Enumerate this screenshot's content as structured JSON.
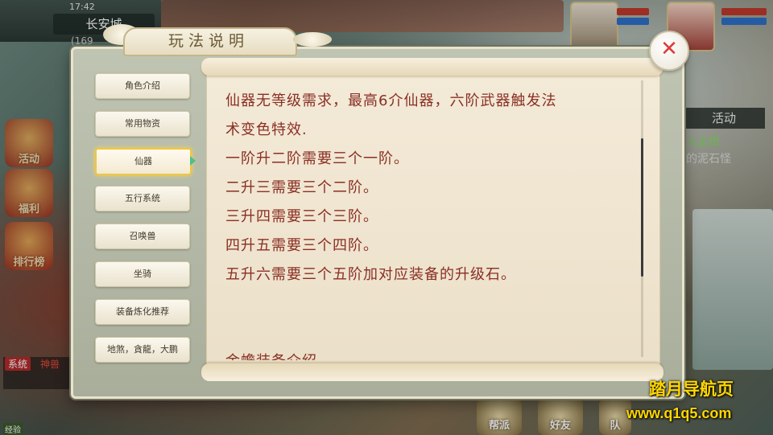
{
  "hud": {
    "time": "17:42",
    "city": "长安城",
    "coord": "(169",
    "left_icons": [
      "活动",
      "福利",
      "排行榜"
    ],
    "right_tab": "活动",
    "quest_line1": "入尘世",
    "quest_line2": "的泥石怪",
    "chat_tag": "系统",
    "chat_text": "神兽",
    "bottom_buttons": [
      "帮派",
      "好友",
      "队"
    ],
    "bottom_left_label": "经验"
  },
  "dialog": {
    "title": "玩法说明",
    "menu": [
      {
        "label": "角色介绍",
        "active": false
      },
      {
        "label": "常用物资",
        "active": false
      },
      {
        "label": "仙器",
        "active": true
      },
      {
        "label": "五行系统",
        "active": false
      },
      {
        "label": "召唤兽",
        "active": false
      },
      {
        "label": "坐骑",
        "active": false
      },
      {
        "label": "装备炼化推荐",
        "active": false
      },
      {
        "label": "地煞，貪龍，大鹏",
        "active": false
      }
    ],
    "content_lines": [
      "仙器无等级需求，最高6介仙器，六阶武器触发法",
      "术变色特效.",
      "一阶升二阶需要三个一阶。",
      "二升三需要三个二阶。",
      "三升四需要三个三阶。",
      "四升五需要三个四阶。",
      "五升六需要三个五阶加对应装备的升级石。",
      "",
      "",
      "金蟾装备介绍"
    ],
    "close_icon": "close-icon"
  },
  "watermark": {
    "line1": "踏月导航页",
    "line2": "www.q1q5.com"
  },
  "colors": {
    "content_text": "#8a2f24",
    "watermark": "#ffd700",
    "close_x": "#e03a3a"
  }
}
